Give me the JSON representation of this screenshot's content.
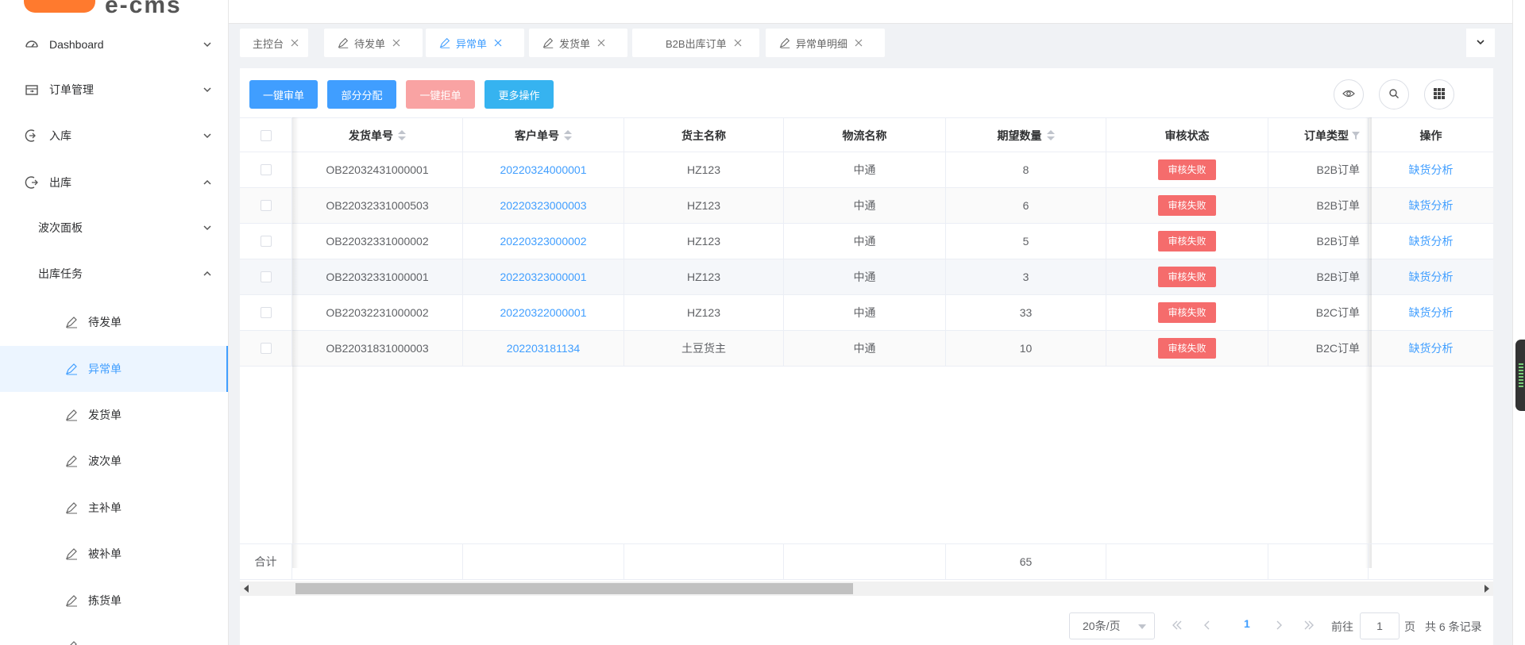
{
  "sidebar": {
    "logo_text": "e-cms",
    "items": [
      {
        "label": "Dashboard",
        "icon": "dashboard-icon",
        "arrow": "down"
      },
      {
        "label": "订单管理",
        "icon": "order-icon",
        "arrow": "down"
      },
      {
        "label": "入库",
        "icon": "inbound-icon",
        "arrow": "down"
      },
      {
        "label": "出库",
        "icon": "outbound-icon",
        "arrow": "up"
      },
      {
        "label": "波次面板",
        "arrow": "down"
      },
      {
        "label": "出库任务",
        "arrow": "up"
      },
      {
        "label": "待发单",
        "icon": "edit-icon"
      },
      {
        "label": "异常单",
        "icon": "edit-icon",
        "active": true
      },
      {
        "label": "发货单",
        "icon": "edit-icon"
      },
      {
        "label": "波次单",
        "icon": "edit-icon"
      },
      {
        "label": "主补单",
        "icon": "edit-icon"
      },
      {
        "label": "被补单",
        "icon": "edit-icon"
      },
      {
        "label": "拣货单",
        "icon": "edit-icon"
      }
    ]
  },
  "tabs": [
    {
      "label": "主控台"
    },
    {
      "label": "待发单",
      "icon": "edit-icon"
    },
    {
      "label": "异常单",
      "icon": "edit-icon",
      "active": true
    },
    {
      "label": "发货单",
      "icon": "edit-icon"
    },
    {
      "label": "B2B出库订单"
    },
    {
      "label": "异常单明细",
      "icon": "edit-icon"
    }
  ],
  "toolbar": {
    "btn_audit": "一键审单",
    "btn_partial": "部分分配",
    "btn_reject": "一键拒单",
    "btn_more": "更多操作",
    "icons": [
      "eye-icon",
      "search-icon",
      "grid-icon"
    ]
  },
  "table": {
    "columns": [
      "发货单号",
      "客户单号",
      "货主名称",
      "物流名称",
      "期望数量",
      "审核状态",
      "订单类型",
      "操作"
    ],
    "rows": [
      {
        "ship_no": "OB22032431000001",
        "cust_no": "20220324000001",
        "owner": "HZ123",
        "logistics": "中通",
        "qty": "8",
        "status": "审核失败",
        "type": "B2B订单",
        "action": "缺货分析"
      },
      {
        "ship_no": "OB22032331000503",
        "cust_no": "20220323000003",
        "owner": "HZ123",
        "logistics": "中通",
        "qty": "6",
        "status": "审核失败",
        "type": "B2B订单",
        "action": "缺货分析"
      },
      {
        "ship_no": "OB22032331000002",
        "cust_no": "20220323000002",
        "owner": "HZ123",
        "logistics": "中通",
        "qty": "5",
        "status": "审核失败",
        "type": "B2B订单",
        "action": "缺货分析"
      },
      {
        "ship_no": "OB22032331000001",
        "cust_no": "20220323000001",
        "owner": "HZ123",
        "logistics": "中通",
        "qty": "3",
        "status": "审核失败",
        "type": "B2B订单",
        "action": "缺货分析"
      },
      {
        "ship_no": "OB22032231000002",
        "cust_no": "20220322000001",
        "owner": "HZ123",
        "logistics": "中通",
        "qty": "33",
        "status": "审核失败",
        "type": "B2C订单",
        "action": "缺货分析"
      },
      {
        "ship_no": "OB22031831000003",
        "cust_no": "202203181134",
        "owner": "土豆货主",
        "logistics": "中通",
        "qty": "10",
        "status": "审核失败",
        "type": "B2C订单",
        "action": "缺货分析"
      }
    ],
    "summary_label": "合计",
    "summary_qty": "65"
  },
  "pagination": {
    "page_size": "20条/页",
    "current_page": "1",
    "goto_prefix": "前往",
    "goto_value": "1",
    "goto_suffix": "页",
    "total_text": "共 6 条记录"
  },
  "colors": {
    "primary": "#409eff",
    "danger": "#f56c6c",
    "disabled_danger": "#f9a3a3",
    "info": "#36b3f0",
    "logo": "#ff7a2e"
  }
}
